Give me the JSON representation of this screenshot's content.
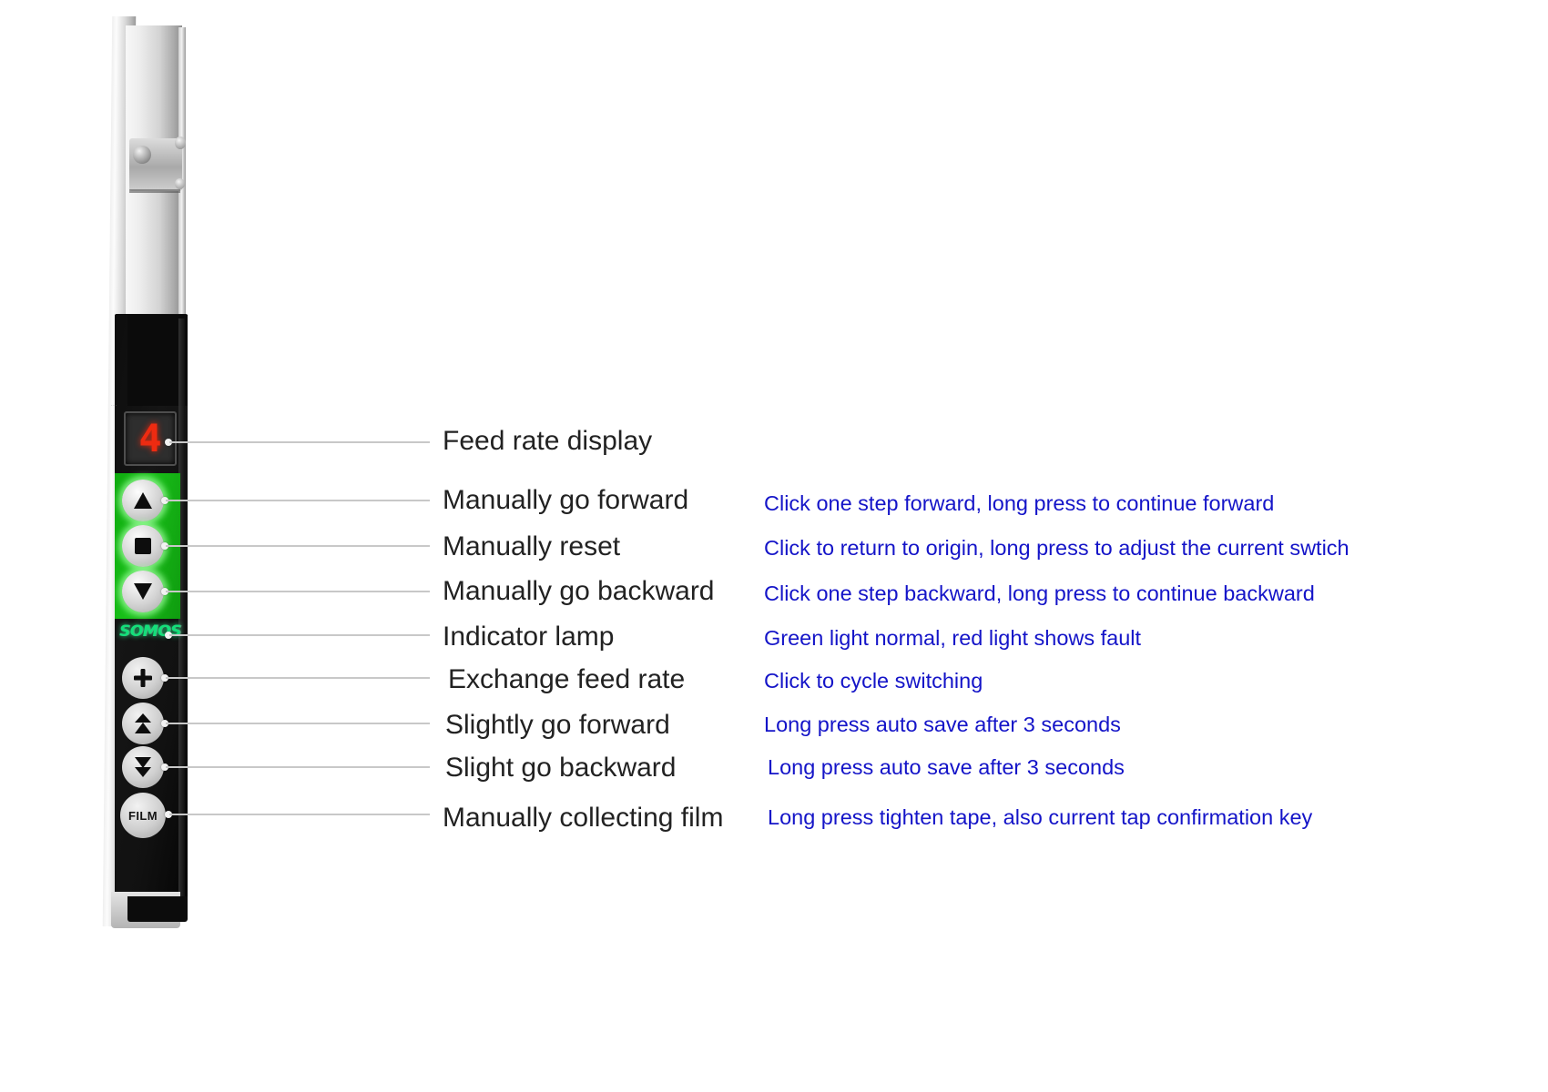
{
  "figure": {
    "kind": "annotated-product-photo",
    "subject": "Stretch wrapping machine control panel",
    "brand_logo": "SOMOS",
    "display_value": "4",
    "colors": {
      "label_text": "#222222",
      "description_text": "#1414c8",
      "callout_line": "#c8c8c8",
      "keypad_green": "#19c119",
      "display_red": "#ee2b11",
      "logo_green": "#13e07a"
    }
  },
  "panel": {
    "buttons": [
      {
        "id": "feed-rate-display",
        "icon": "seven-segment-display",
        "glyph": "4"
      },
      {
        "id": "manually-go-forward",
        "icon": "triangle-up-icon"
      },
      {
        "id": "manually-reset",
        "icon": "square-stop-icon"
      },
      {
        "id": "manually-go-backward",
        "icon": "triangle-down-icon"
      },
      {
        "id": "indicator-lamp",
        "icon": "brand-logo"
      },
      {
        "id": "exchange-feed-rate",
        "icon": "plus-icon"
      },
      {
        "id": "slightly-go-forward",
        "icon": "double-triangle-up-icon"
      },
      {
        "id": "slight-go-backward",
        "icon": "double-triangle-down-icon"
      },
      {
        "id": "manually-collecting-film",
        "icon": "film-text-icon",
        "text": "FILM"
      }
    ]
  },
  "callouts": [
    {
      "key": "feed-rate-display",
      "label": "Feed rate display",
      "description": ""
    },
    {
      "key": "manually-go-forward",
      "label": "Manually go forward",
      "description": "Click one step forward, long press to continue forward"
    },
    {
      "key": "manually-reset",
      "label": "Manually reset",
      "description": "Click to return to origin, long press to adjust the current swtich"
    },
    {
      "key": "manually-go-backward",
      "label": "Manually go backward",
      "description": "Click one step backward, long press to continue backward"
    },
    {
      "key": "indicator-lamp",
      "label": "Indicator lamp",
      "description": "Green light normal, red light shows fault"
    },
    {
      "key": "exchange-feed-rate",
      "label": "Exchange feed rate",
      "description": "Click to cycle switching"
    },
    {
      "key": "slightly-go-forward",
      "label": "Slightly go forward",
      "description": "Long press auto save after 3 seconds"
    },
    {
      "key": "slight-go-backward",
      "label": "Slight go backward",
      "description": "Long press auto save after 3 seconds"
    },
    {
      "key": "manually-collecting-film",
      "label": "Manually collecting film",
      "description": "Long press tighten tape, also current tap confirmation key"
    }
  ]
}
